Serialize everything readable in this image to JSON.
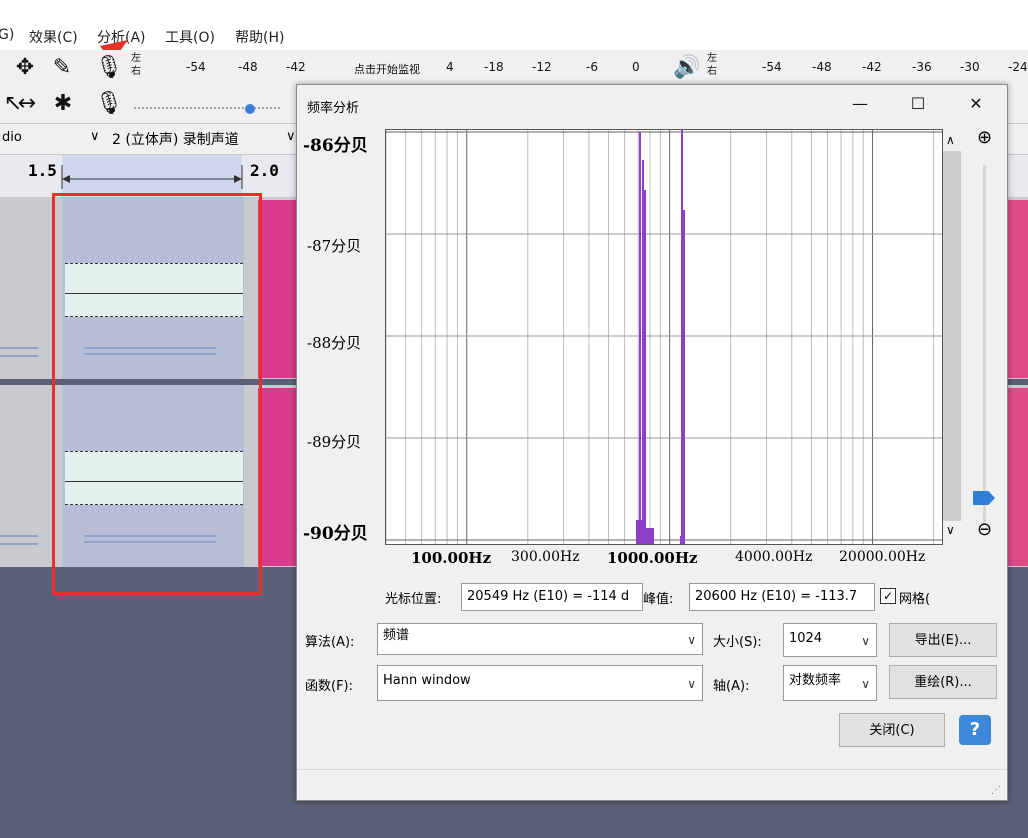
{
  "menu": {
    "items": [
      "G)",
      "效果(C)",
      "分析(A)",
      "工具(O)",
      "帮助(H)"
    ]
  },
  "meters": {
    "record_ticks": [
      "-54",
      "-48",
      "-42",
      "点击开始监视",
      "4",
      "-18",
      "-12",
      "-6",
      "0"
    ],
    "play_ticks": [
      "-54",
      "-48",
      "-42",
      "-36",
      "-30",
      "-24"
    ],
    "left_label": "左",
    "right_label": "右"
  },
  "device": {
    "host_partial": "dio",
    "channels": "2 (立体声) 录制声道"
  },
  "timeline": {
    "tick_a": "1.5",
    "tick_b": "2.0"
  },
  "dialog": {
    "title": "频率分析",
    "min": "—",
    "max": "☐",
    "close": "✕",
    "cursor_label": "光标位置:",
    "cursor_value": "20549 Hz (E10) = -114 d",
    "peak_label": "峰值:",
    "peak_value": "20600 Hz (E10) = -113.7",
    "grid_label": "网格(",
    "grid_checked": true,
    "algorithm_label": "算法(A):",
    "algorithm_value": "频谱",
    "size_label": "大小(S):",
    "size_value": "1024",
    "export_button": "导出(E)...",
    "function_label": "函数(F):",
    "function_value": "Hann window",
    "axis_label": "轴(A):",
    "axis_value": "对数频率",
    "replot_button": "重绘(R)...",
    "close_button": "关闭(C)",
    "help_button": "?"
  },
  "plot": {
    "y_labels": [
      "-86分贝",
      "-87分贝",
      "-88分贝",
      "-89分贝",
      "-90分贝"
    ],
    "x_labels": [
      "100.00Hz",
      "300.00Hz",
      "1000.00Hz",
      "4000.00Hz",
      "20000.00Hz"
    ],
    "bar_color": "#8e3fc9"
  }
}
